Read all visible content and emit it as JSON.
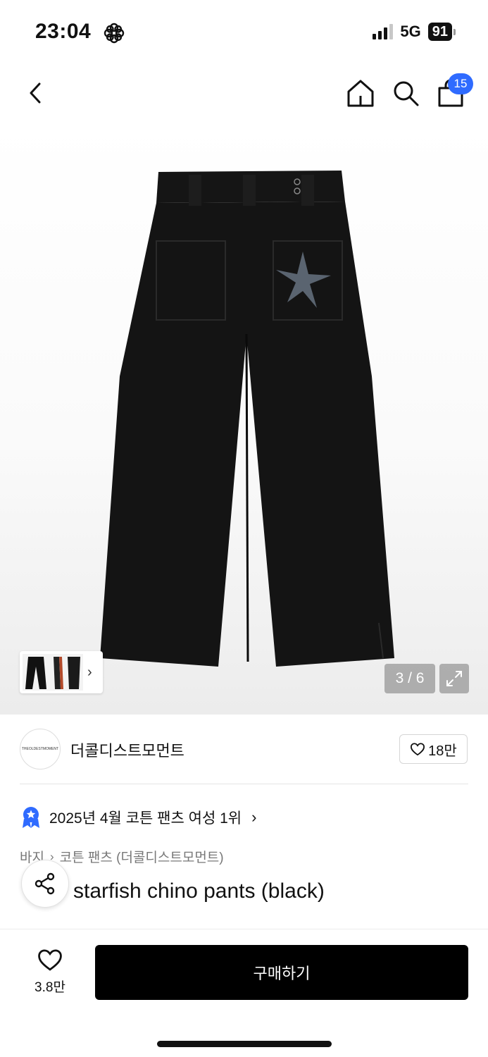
{
  "status_bar": {
    "time": "23:04",
    "network": "5G",
    "battery": "91"
  },
  "header": {
    "cart_count": "15"
  },
  "gallery": {
    "counter": "3 / 6",
    "thumbnail_chevron": "›"
  },
  "brand": {
    "logo_text": "THEOLDESTMOMENT",
    "name": "더콜디스트모먼트",
    "like_count": "18만"
  },
  "ranking": {
    "text": "2025년 4월 코튼 팬츠 여성 1위",
    "chevron": "›"
  },
  "breadcrumb": {
    "category": "바지",
    "separator": "›",
    "subcategory": "코튼 팬츠 (더콜디스트모먼트)"
  },
  "product": {
    "title": "starfish chino pants (black)"
  },
  "bottom_bar": {
    "wish_count": "3.8만",
    "buy_label": "구매하기"
  },
  "colors": {
    "accent": "#2f6bff",
    "primary_button": "#000000"
  }
}
